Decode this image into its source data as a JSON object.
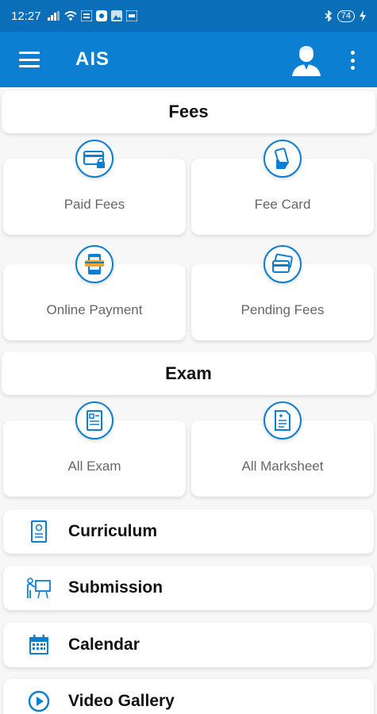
{
  "status": {
    "time": "12:27",
    "battery": "74"
  },
  "app": {
    "title": "AIS"
  },
  "sections": {
    "fees": "Fees",
    "exam": "Exam"
  },
  "tiles": {
    "paid_fees": "Paid Fees",
    "fee_card": "Fee Card",
    "online_payment": "Online Payment",
    "pending_fees": "Pending Fees",
    "all_exam": "All Exam",
    "all_marksheet": "All Marksheet"
  },
  "menu": {
    "curriculum": "Curriculum",
    "submission": "Submission",
    "calendar": "Calendar",
    "video_gallery": "Video Gallery"
  },
  "colors": {
    "status_bar": "#0a6fb8",
    "app_bar": "#0c7fd2",
    "accent": "#0c7fd2"
  },
  "icons": {
    "paid_fees": "credit-card-lock-icon",
    "fee_card": "hand-card-icon",
    "online_payment": "mobile-payment-icon",
    "pending_fees": "cards-icon",
    "all_exam": "exam-sheet-icon",
    "all_marksheet": "marksheet-icon",
    "curriculum": "document-badge-icon",
    "submission": "presentation-board-icon",
    "calendar": "calendar-icon",
    "video_gallery": "play-circle-icon"
  }
}
